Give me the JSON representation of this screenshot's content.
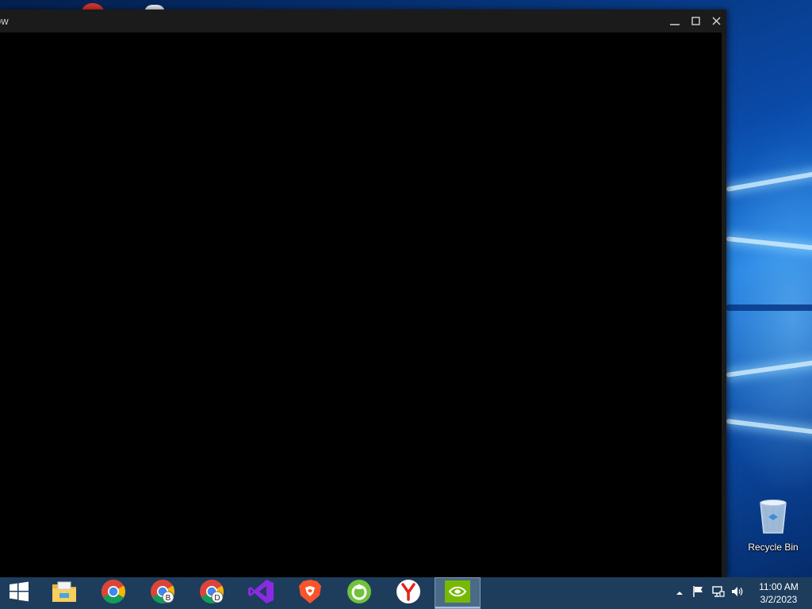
{
  "window": {
    "title": "ow",
    "controls": {
      "minimize_icon": "minimize-icon",
      "maximize_icon": "maximize-icon",
      "close_icon": "close-icon"
    }
  },
  "desktop": {
    "icons": [
      {
        "label": "Recycle Bin",
        "icon": "recycle-bin-icon"
      }
    ]
  },
  "taskbar": {
    "start_icon": "windows-logo-icon",
    "apps": [
      {
        "name": "File Explorer",
        "icon": "file-explorer-icon"
      },
      {
        "name": "Google Chrome",
        "icon": "chrome-icon"
      },
      {
        "name": "Chrome Beta",
        "icon": "chrome-beta-icon",
        "badge": "B"
      },
      {
        "name": "Chrome Dev",
        "icon": "chrome-dev-icon",
        "badge": "D"
      },
      {
        "name": "Visual Studio",
        "icon": "visual-studio-icon"
      },
      {
        "name": "Brave",
        "icon": "brave-icon"
      },
      {
        "name": "Avast Secure Browser",
        "icon": "green-browser-icon"
      },
      {
        "name": "Yandex Browser",
        "icon": "yandex-icon"
      },
      {
        "name": "NVIDIA",
        "icon": "nvidia-icon",
        "active": true
      }
    ],
    "tray": {
      "icons": [
        "chevron-up-icon",
        "flag-icon",
        "network-icon",
        "volume-icon"
      ],
      "time": "11:00 AM",
      "date": "3/2/2023"
    }
  },
  "colors": {
    "taskbar": "#1e3d5c",
    "window_titlebar": "#1b1b1b",
    "window_body": "#000000",
    "active_app_highlight": "#4a6a88"
  }
}
